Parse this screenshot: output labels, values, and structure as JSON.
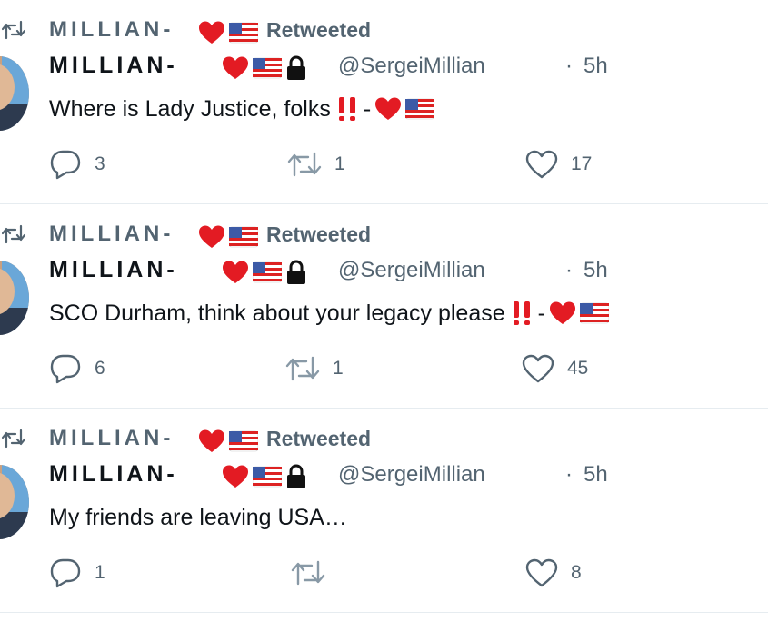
{
  "tweets": [
    {
      "retweeter_name": "MILLIAN-",
      "retweeted_label": "Retweeted",
      "display_name": "MILLIAN-",
      "handle": "@SergeiMillian",
      "separator": "·",
      "time": "5h",
      "text": "Where is Lady Justice, folks",
      "text_tail_dash": "-",
      "replies": "3",
      "retweets": "1",
      "likes": "17"
    },
    {
      "retweeter_name": "MILLIAN-",
      "retweeted_label": "Retweeted",
      "display_name": "MILLIAN-",
      "handle": "@SergeiMillian",
      "separator": "·",
      "time": "5h",
      "text": "SCO Durham, think about your legacy please",
      "text_tail_dash": "-",
      "replies": "6",
      "retweets": "1",
      "likes": "45"
    },
    {
      "retweeter_name": "MILLIAN-",
      "retweeted_label": "Retweeted",
      "display_name": "MILLIAN-",
      "handle": "@SergeiMillian",
      "separator": "·",
      "time": "5h",
      "text": "My friends are leaving USA…",
      "text_tail_dash": "",
      "replies": "1",
      "retweets": "",
      "likes": "8"
    }
  ],
  "icons": {
    "retweet": "retweet-icon",
    "reply": "reply-icon",
    "like": "heart-outline-icon",
    "heart_emoji": "red-heart-emoji-icon",
    "flag_emoji": "us-flag-emoji-icon",
    "lock_emoji": "lock-emoji-icon",
    "exclamation_emoji": "double-exclamation-emoji-icon"
  },
  "colors": {
    "secondary_text": "#536471",
    "primary_text": "#0f1419",
    "heart_red": "#e0245e",
    "emoji_red": "#e31b23",
    "separator": "#e6ecf0"
  }
}
